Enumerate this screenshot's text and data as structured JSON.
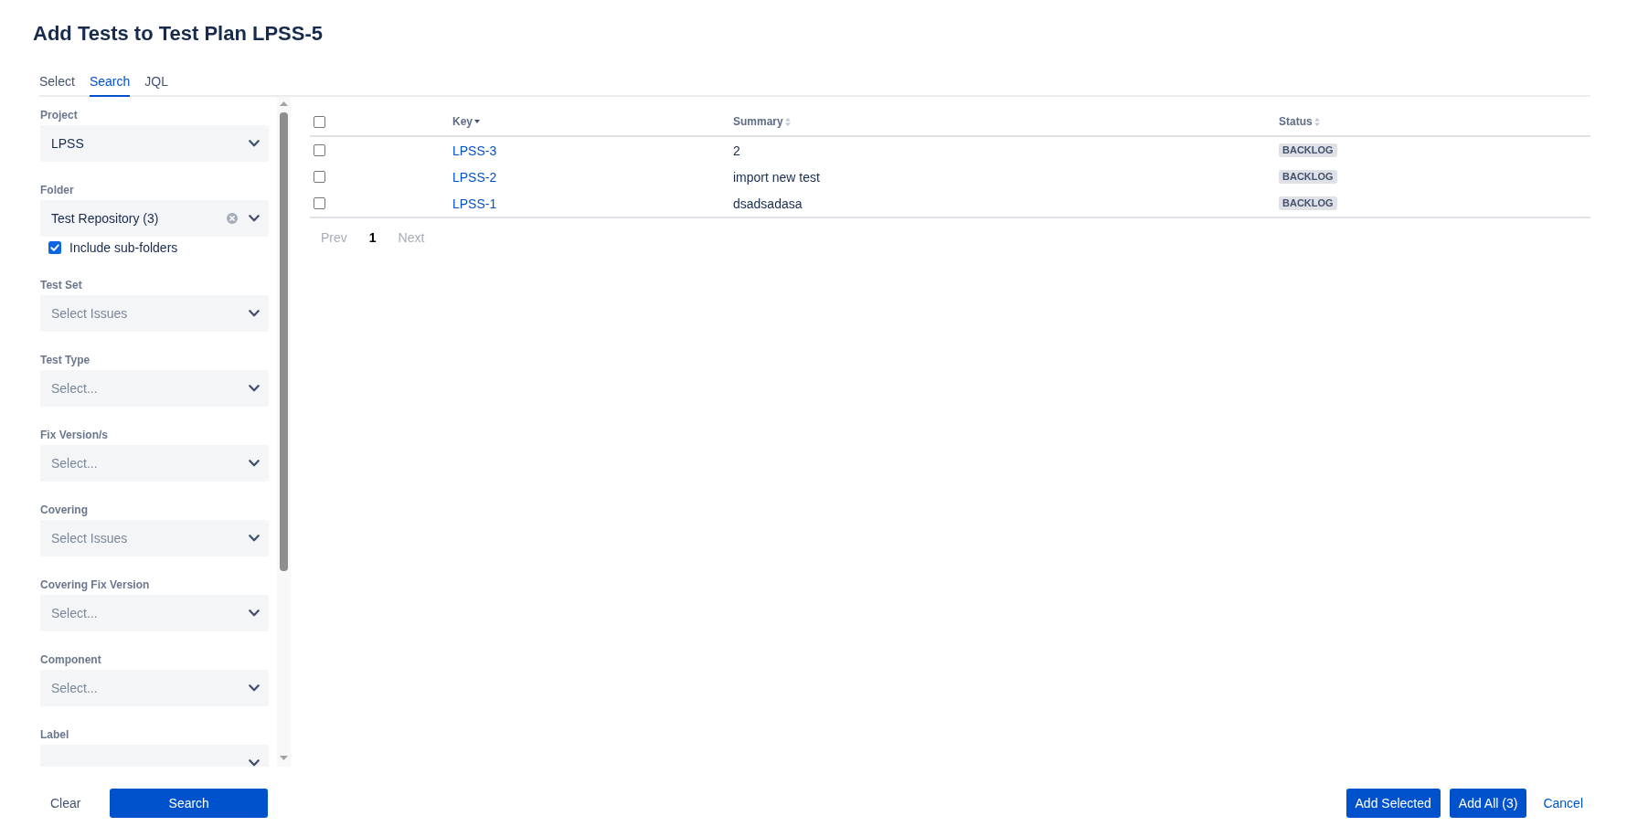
{
  "title": "Add Tests to Test Plan LPSS-5",
  "tabs": [
    {
      "label": "Select",
      "selected": false
    },
    {
      "label": "Search",
      "selected": true
    },
    {
      "label": "JQL",
      "selected": false
    }
  ],
  "filters": [
    {
      "label": "Project",
      "value": "LPSS"
    },
    {
      "label": "Folder",
      "value": "Test Repository (3)",
      "clearable": true,
      "option": {
        "label": "Include sub-folders",
        "checked": true
      }
    },
    {
      "label": "Test Set",
      "placeholder": "Select Issues"
    },
    {
      "label": "Test Type",
      "placeholder": "Select..."
    },
    {
      "label": "Fix Version/s",
      "placeholder": "Select..."
    },
    {
      "label": "Covering",
      "placeholder": "Select Issues"
    },
    {
      "label": "Covering Fix Version",
      "placeholder": "Select..."
    },
    {
      "label": "Component",
      "placeholder": "Select..."
    },
    {
      "label": "Label"
    }
  ],
  "actions": [
    {
      "label": "Clear",
      "kind": "subtle"
    },
    {
      "label": "Search",
      "kind": "primary"
    }
  ],
  "table": {
    "select_all": {
      "checked": false
    },
    "columns": [
      {
        "label": "Key",
        "sorted": true,
        "descending": true
      },
      {
        "label": "Summary",
        "sorted": false
      },
      {
        "label": "Status",
        "sorted": false
      }
    ],
    "rows": [
      {
        "selected": false,
        "key": "LPSS-3",
        "summary": "2",
        "status": "BACKLOG"
      },
      {
        "selected": false,
        "key": "LPSS-2",
        "summary": "import new test",
        "status": "BACKLOG"
      },
      {
        "selected": false,
        "key": "LPSS-1",
        "summary": "dsadsadasa",
        "status": "BACKLOG"
      }
    ]
  },
  "pagination": {
    "prev": {
      "label": "Prev",
      "disabled": true
    },
    "pages": [
      {
        "label": "1",
        "selected": true
      }
    ],
    "next": {
      "label": "Next",
      "disabled": true
    }
  },
  "footer_buttons": [
    {
      "label": "Add Selected",
      "kind": "primary"
    },
    {
      "label": "Add All (3)",
      "kind": "primary"
    },
    {
      "label": "Cancel",
      "kind": "link"
    }
  ]
}
